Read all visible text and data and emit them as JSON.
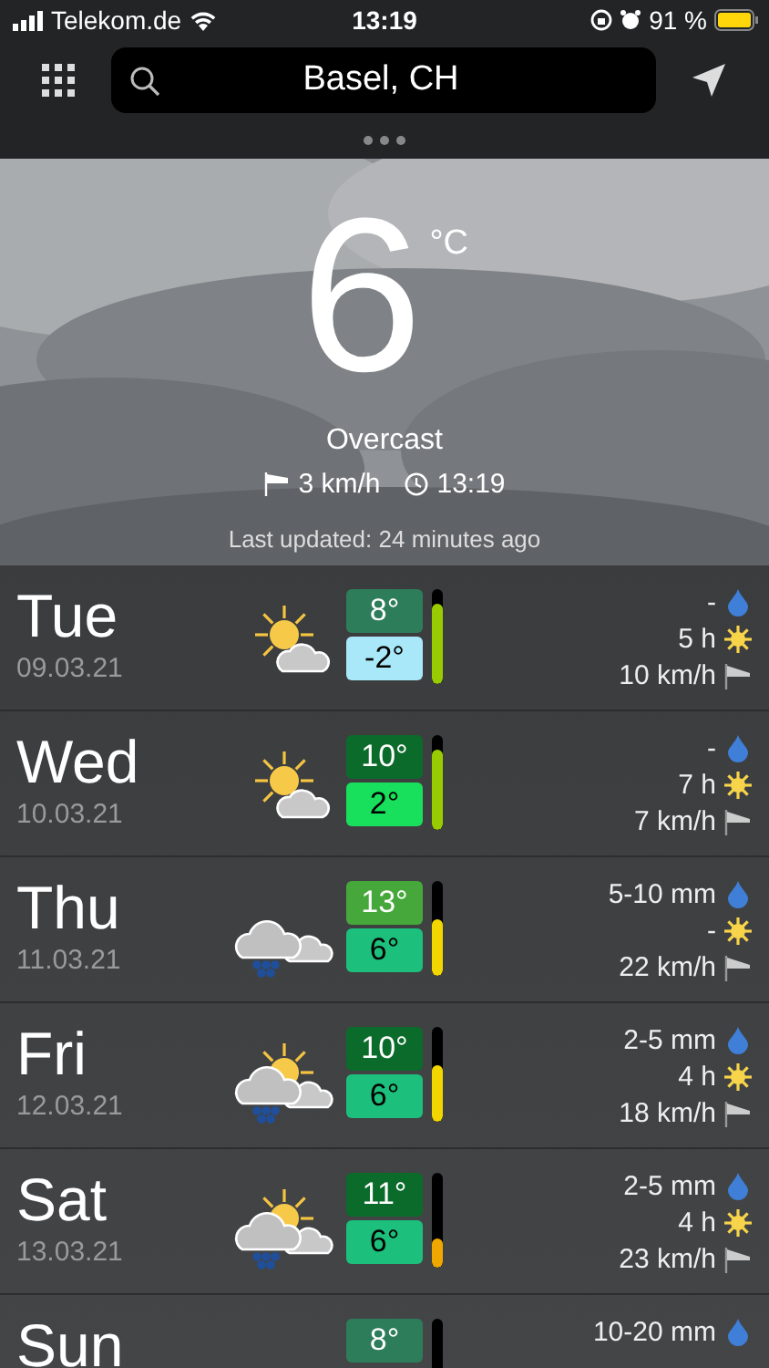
{
  "status_bar": {
    "carrier": "Telekom.de",
    "time": "13:19",
    "battery": "91 %"
  },
  "search": {
    "value": "Basel, CH"
  },
  "current": {
    "temperature": "6",
    "unit": "°C",
    "condition": "Overcast",
    "wind": "3 km/h",
    "time": "13:19",
    "updated": "Last updated: 24 minutes ago"
  },
  "days": [
    {
      "day": "Tue",
      "date": "09.03.21",
      "kind": "sun_cloud",
      "high": {
        "text": "8°",
        "color": "#2e7d5a"
      },
      "low": {
        "text": "-2°",
        "color": "#a8e8f8"
      },
      "bar": {
        "level": 0.85,
        "color": "#99cc00"
      },
      "precip": "-",
      "sun": "5 h",
      "wind": "10 km/h"
    },
    {
      "day": "Wed",
      "date": "10.03.21",
      "kind": "sun_cloud",
      "high": {
        "text": "10°",
        "color": "#0b6b2a"
      },
      "low": {
        "text": "2°",
        "color": "#18e05c"
      },
      "bar": {
        "level": 0.85,
        "color": "#99cc00"
      },
      "precip": "-",
      "sun": "7 h",
      "wind": "7 km/h"
    },
    {
      "day": "Thu",
      "date": "11.03.21",
      "kind": "snow_cloud",
      "high": {
        "text": "13°",
        "color": "#46a83a"
      },
      "low": {
        "text": "6°",
        "color": "#1dbf7c"
      },
      "bar": {
        "level": 0.6,
        "color": "#f2d600"
      },
      "precip": "5-10 mm",
      "sun": "-",
      "wind": "22 km/h"
    },
    {
      "day": "Fri",
      "date": "12.03.21",
      "kind": "sun_snow_cloud",
      "high": {
        "text": "10°",
        "color": "#0b6b2a"
      },
      "low": {
        "text": "6°",
        "color": "#1dbf7c"
      },
      "bar": {
        "level": 0.6,
        "color": "#f2d600"
      },
      "precip": "2-5 mm",
      "sun": "4 h",
      "wind": "18 km/h"
    },
    {
      "day": "Sat",
      "date": "13.03.21",
      "kind": "sun_snow_cloud",
      "high": {
        "text": "11°",
        "color": "#0b6b2a"
      },
      "low": {
        "text": "6°",
        "color": "#1dbf7c"
      },
      "bar": {
        "level": 0.3,
        "color": "#f0a800"
      },
      "precip": "2-5 mm",
      "sun": "4 h",
      "wind": "23 km/h"
    },
    {
      "day": "Sun",
      "high": {
        "text": "8°",
        "color": "#2e7d5a"
      },
      "precip": "10-20 mm"
    }
  ]
}
